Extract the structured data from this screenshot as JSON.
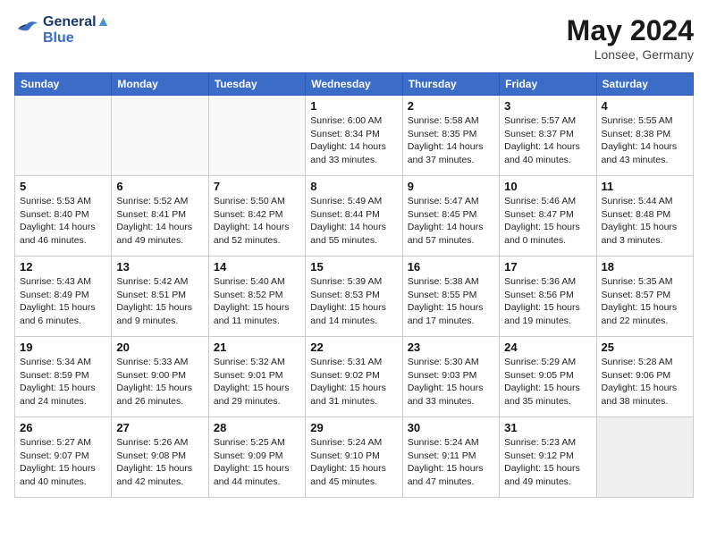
{
  "logo": {
    "line1": "General",
    "line2": "Blue"
  },
  "title": "May 2024",
  "location": "Lonsee, Germany",
  "days_of_week": [
    "Sunday",
    "Monday",
    "Tuesday",
    "Wednesday",
    "Thursday",
    "Friday",
    "Saturday"
  ],
  "weeks": [
    [
      {
        "day": "",
        "info": ""
      },
      {
        "day": "",
        "info": ""
      },
      {
        "day": "",
        "info": ""
      },
      {
        "day": "1",
        "info": "Sunrise: 6:00 AM\nSunset: 8:34 PM\nDaylight: 14 hours\nand 33 minutes."
      },
      {
        "day": "2",
        "info": "Sunrise: 5:58 AM\nSunset: 8:35 PM\nDaylight: 14 hours\nand 37 minutes."
      },
      {
        "day": "3",
        "info": "Sunrise: 5:57 AM\nSunset: 8:37 PM\nDaylight: 14 hours\nand 40 minutes."
      },
      {
        "day": "4",
        "info": "Sunrise: 5:55 AM\nSunset: 8:38 PM\nDaylight: 14 hours\nand 43 minutes."
      }
    ],
    [
      {
        "day": "5",
        "info": "Sunrise: 5:53 AM\nSunset: 8:40 PM\nDaylight: 14 hours\nand 46 minutes."
      },
      {
        "day": "6",
        "info": "Sunrise: 5:52 AM\nSunset: 8:41 PM\nDaylight: 14 hours\nand 49 minutes."
      },
      {
        "day": "7",
        "info": "Sunrise: 5:50 AM\nSunset: 8:42 PM\nDaylight: 14 hours\nand 52 minutes."
      },
      {
        "day": "8",
        "info": "Sunrise: 5:49 AM\nSunset: 8:44 PM\nDaylight: 14 hours\nand 55 minutes."
      },
      {
        "day": "9",
        "info": "Sunrise: 5:47 AM\nSunset: 8:45 PM\nDaylight: 14 hours\nand 57 minutes."
      },
      {
        "day": "10",
        "info": "Sunrise: 5:46 AM\nSunset: 8:47 PM\nDaylight: 15 hours\nand 0 minutes."
      },
      {
        "day": "11",
        "info": "Sunrise: 5:44 AM\nSunset: 8:48 PM\nDaylight: 15 hours\nand 3 minutes."
      }
    ],
    [
      {
        "day": "12",
        "info": "Sunrise: 5:43 AM\nSunset: 8:49 PM\nDaylight: 15 hours\nand 6 minutes."
      },
      {
        "day": "13",
        "info": "Sunrise: 5:42 AM\nSunset: 8:51 PM\nDaylight: 15 hours\nand 9 minutes."
      },
      {
        "day": "14",
        "info": "Sunrise: 5:40 AM\nSunset: 8:52 PM\nDaylight: 15 hours\nand 11 minutes."
      },
      {
        "day": "15",
        "info": "Sunrise: 5:39 AM\nSunset: 8:53 PM\nDaylight: 15 hours\nand 14 minutes."
      },
      {
        "day": "16",
        "info": "Sunrise: 5:38 AM\nSunset: 8:55 PM\nDaylight: 15 hours\nand 17 minutes."
      },
      {
        "day": "17",
        "info": "Sunrise: 5:36 AM\nSunset: 8:56 PM\nDaylight: 15 hours\nand 19 minutes."
      },
      {
        "day": "18",
        "info": "Sunrise: 5:35 AM\nSunset: 8:57 PM\nDaylight: 15 hours\nand 22 minutes."
      }
    ],
    [
      {
        "day": "19",
        "info": "Sunrise: 5:34 AM\nSunset: 8:59 PM\nDaylight: 15 hours\nand 24 minutes."
      },
      {
        "day": "20",
        "info": "Sunrise: 5:33 AM\nSunset: 9:00 PM\nDaylight: 15 hours\nand 26 minutes."
      },
      {
        "day": "21",
        "info": "Sunrise: 5:32 AM\nSunset: 9:01 PM\nDaylight: 15 hours\nand 29 minutes."
      },
      {
        "day": "22",
        "info": "Sunrise: 5:31 AM\nSunset: 9:02 PM\nDaylight: 15 hours\nand 31 minutes."
      },
      {
        "day": "23",
        "info": "Sunrise: 5:30 AM\nSunset: 9:03 PM\nDaylight: 15 hours\nand 33 minutes."
      },
      {
        "day": "24",
        "info": "Sunrise: 5:29 AM\nSunset: 9:05 PM\nDaylight: 15 hours\nand 35 minutes."
      },
      {
        "day": "25",
        "info": "Sunrise: 5:28 AM\nSunset: 9:06 PM\nDaylight: 15 hours\nand 38 minutes."
      }
    ],
    [
      {
        "day": "26",
        "info": "Sunrise: 5:27 AM\nSunset: 9:07 PM\nDaylight: 15 hours\nand 40 minutes."
      },
      {
        "day": "27",
        "info": "Sunrise: 5:26 AM\nSunset: 9:08 PM\nDaylight: 15 hours\nand 42 minutes."
      },
      {
        "day": "28",
        "info": "Sunrise: 5:25 AM\nSunset: 9:09 PM\nDaylight: 15 hours\nand 44 minutes."
      },
      {
        "day": "29",
        "info": "Sunrise: 5:24 AM\nSunset: 9:10 PM\nDaylight: 15 hours\nand 45 minutes."
      },
      {
        "day": "30",
        "info": "Sunrise: 5:24 AM\nSunset: 9:11 PM\nDaylight: 15 hours\nand 47 minutes."
      },
      {
        "day": "31",
        "info": "Sunrise: 5:23 AM\nSunset: 9:12 PM\nDaylight: 15 hours\nand 49 minutes."
      },
      {
        "day": "",
        "info": ""
      }
    ]
  ]
}
